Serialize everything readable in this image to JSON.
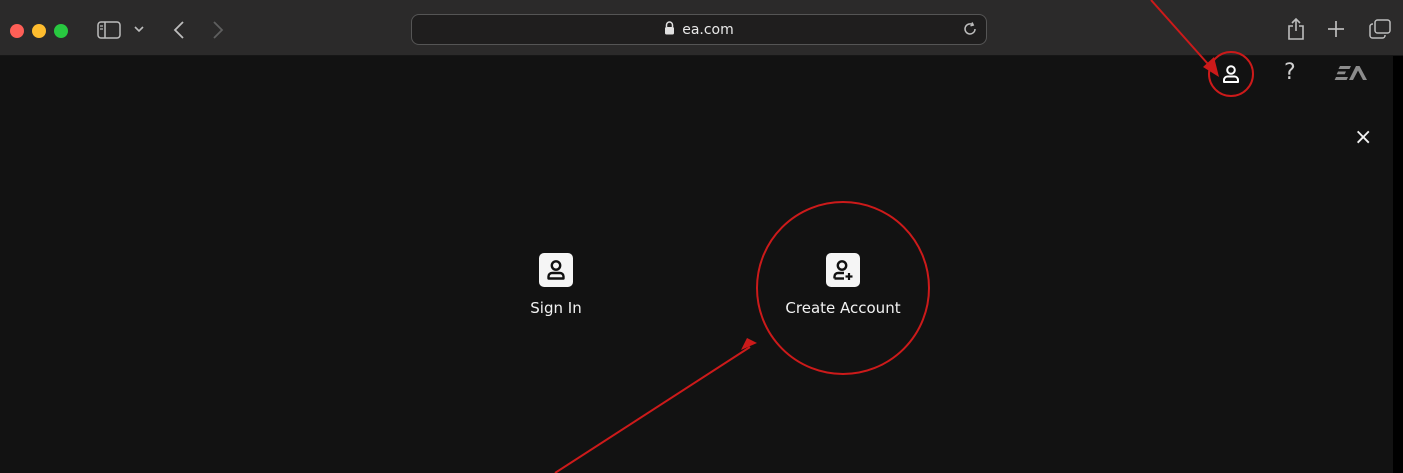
{
  "browser": {
    "address_bar": {
      "url": "ea.com"
    }
  },
  "site_header": {
    "icons": [
      "account-icon",
      "help-icon",
      "ea-logo"
    ],
    "help_glyph": "?"
  },
  "overlay": {
    "close_glyph": "×",
    "sign_in": {
      "label": "Sign In",
      "icon": "person-icon"
    },
    "create_account": {
      "label": "Create Account",
      "icon": "person-add-icon"
    }
  },
  "annotations": {
    "color": "#cc1a1a"
  },
  "colors": {
    "toolbar_bg": "#2b2a2a",
    "page_bg": "#121212",
    "traffic_red": "#fe5f57",
    "traffic_yellow": "#febc2e",
    "traffic_green": "#28c840"
  }
}
